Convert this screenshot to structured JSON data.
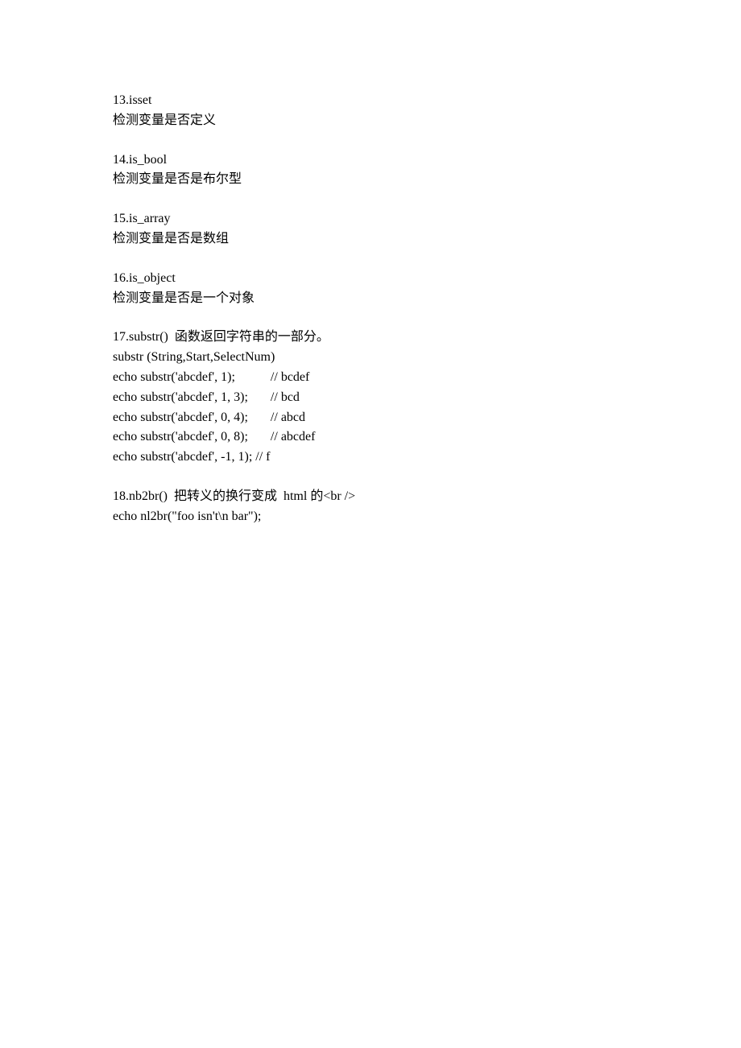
{
  "sections": [
    {
      "lines": [
        "13.isset",
        "检测变量是否定义"
      ]
    },
    {
      "lines": [
        "14.is_bool",
        "检测变量是否是布尔型"
      ]
    },
    {
      "lines": [
        "15.is_array",
        "检测变量是否是数组"
      ]
    },
    {
      "lines": [
        "16.is_object",
        "检测变量是否是一个对象"
      ]
    },
    {
      "lines": [
        "17.substr()  函数返回字符串的一部分。",
        "substr (String,Start,SelectNum)",
        "echo substr('abcdef', 1);           // bcdef",
        "echo substr('abcdef', 1, 3);       // bcd",
        "echo substr('abcdef', 0, 4);       // abcd",
        "echo substr('abcdef', 0, 8);       // abcdef",
        "echo substr('abcdef', -1, 1); // f"
      ]
    },
    {
      "lines": [
        "18.nb2br()  把转义的换行变成  html 的<br />",
        "echo nl2br(\"foo isn't\\n bar\");"
      ]
    }
  ]
}
